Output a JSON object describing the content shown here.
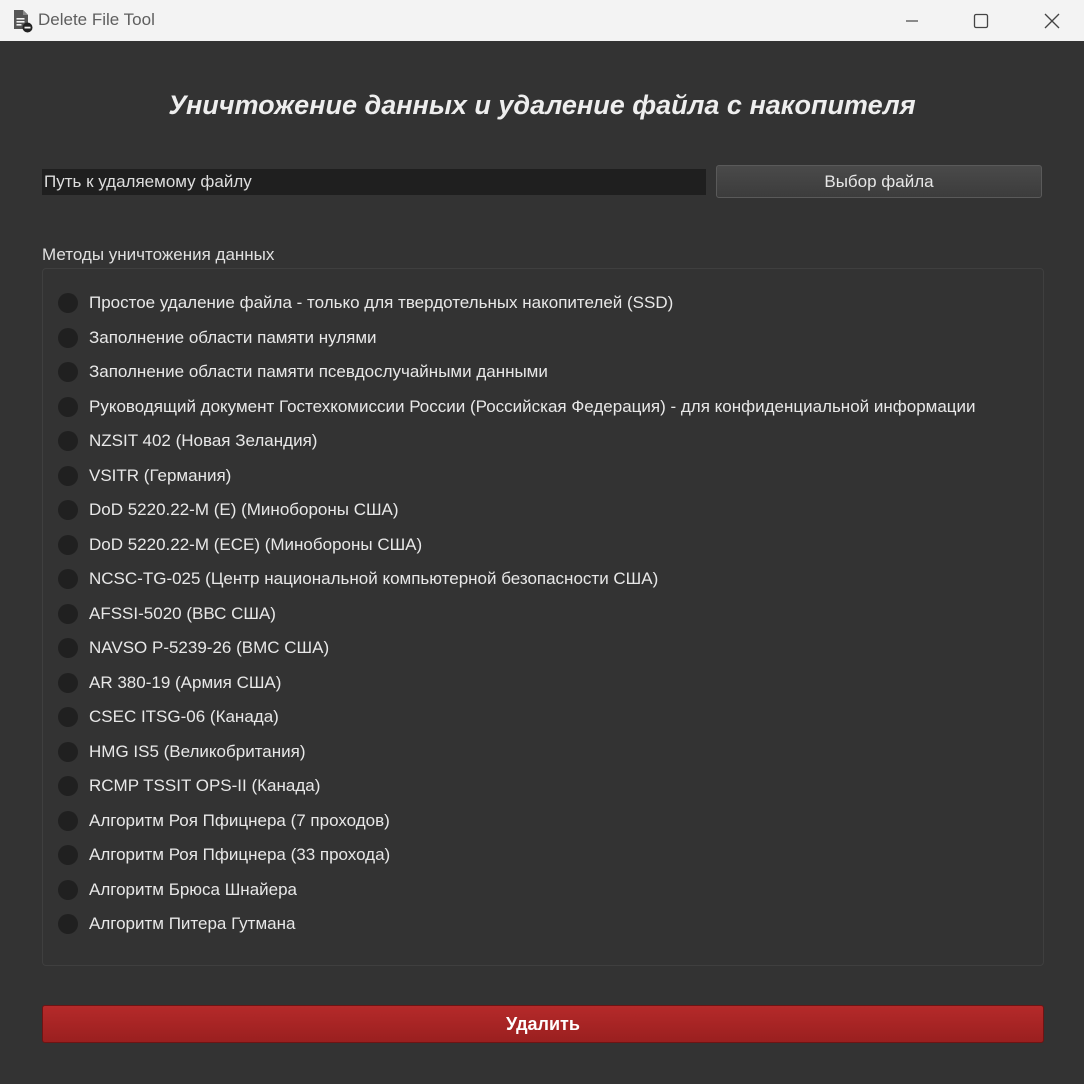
{
  "window": {
    "title": "Delete File Tool"
  },
  "heading": "Уничтожение данных и удаление файла с накопителя",
  "file": {
    "path_placeholder": "Путь к удаляемому файлу",
    "path_value": "",
    "choose_label": "Выбор файла"
  },
  "methods": {
    "label": "Методы уничтожения данных",
    "selected": null,
    "items": [
      {
        "label": "Простое удаление файла - только для твердотельных накопителей (SSD)"
      },
      {
        "label": "Заполнение области памяти нулями"
      },
      {
        "label": "Заполнение области памяти псевдослучайными данными"
      },
      {
        "label": "Руководящий документ Гостехкомиссии России (Российская Федерация) - для конфиденциальной информации"
      },
      {
        "label": "NZSIT 402 (Новая Зеландия)"
      },
      {
        "label": "VSITR (Германия)"
      },
      {
        "label": "DoD 5220.22-M (E) (Минобороны США)"
      },
      {
        "label": "DoD 5220.22-M (ECE) (Минобороны США)"
      },
      {
        "label": "NCSC-TG-025 (Центр национальной компьютерной безопасности США)"
      },
      {
        "label": "AFSSI-5020 (ВВС США)"
      },
      {
        "label": "NAVSO P-5239-26 (ВМС США)"
      },
      {
        "label": "AR 380-19 (Армия США)"
      },
      {
        "label": "CSEC ITSG-06 (Канада)"
      },
      {
        "label": "HMG IS5 (Великобритания)"
      },
      {
        "label": "RCMP TSSIT OPS-II (Канада)"
      },
      {
        "label": "Алгоритм Роя Пфицнера (7 проходов)"
      },
      {
        "label": "Алгоритм Роя Пфицнера (33 прохода)"
      },
      {
        "label": "Алгоритм Брюса Шнайера"
      },
      {
        "label": "Алгоритм Питера Гутмана"
      }
    ]
  },
  "actions": {
    "delete_label": "Удалить"
  },
  "colors": {
    "background": "#333333",
    "titlebar": "#f3f3f3",
    "delete_button": "#a82424",
    "input_background": "#1f1f1f"
  },
  "icons": {
    "app": "file-delete-icon",
    "minimize": "minimize-icon",
    "maximize": "maximize-icon",
    "close": "close-icon",
    "radio": "radio-unchecked-icon"
  }
}
